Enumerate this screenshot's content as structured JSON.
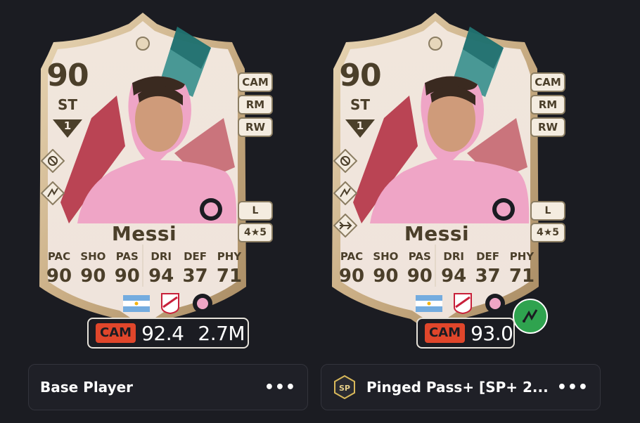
{
  "colors": {
    "background": "#1b1c22",
    "card_text": "#4b3f2a",
    "position_chip": "#e0462b",
    "evolution_badge": "#2fa34f"
  },
  "cards": [
    {
      "rating": "90",
      "position": "ST",
      "rank": "1",
      "alt_positions": [
        "CAM",
        "RM",
        "RW"
      ],
      "preferred_foot": "L",
      "skill_weak": "4★5",
      "name": "Messi",
      "stats": [
        {
          "label": "PAC",
          "value": "90"
        },
        {
          "label": "SHO",
          "value": "90"
        },
        {
          "label": "PAS",
          "value": "90"
        },
        {
          "label": "DRI",
          "value": "94"
        },
        {
          "label": "DEF",
          "value": "37"
        },
        {
          "label": "PHY",
          "value": "71"
        }
      ],
      "playstyles": [
        "finesse-shot-icon",
        "tiki-taka-icon"
      ],
      "price": {
        "position": "CAM",
        "rating": "92.4",
        "coins": "2.7M"
      },
      "title": "Base Player"
    },
    {
      "rating": "90",
      "position": "ST",
      "rank": "1",
      "alt_positions": [
        "CAM",
        "RM",
        "RW"
      ],
      "preferred_foot": "L",
      "skill_weak": "4★5",
      "name": "Messi",
      "stats": [
        {
          "label": "PAC",
          "value": "90"
        },
        {
          "label": "SHO",
          "value": "90"
        },
        {
          "label": "PAS",
          "value": "90"
        },
        {
          "label": "DRI",
          "value": "94"
        },
        {
          "label": "DEF",
          "value": "37"
        },
        {
          "label": "PHY",
          "value": "71"
        }
      ],
      "playstyles": [
        "finesse-shot-icon",
        "tiki-taka-icon",
        "incisive-pass-icon"
      ],
      "price": {
        "position": "CAM",
        "rating": "93.0"
      },
      "title": "Pinged Pass+ [SP+ 2..."
    }
  ]
}
